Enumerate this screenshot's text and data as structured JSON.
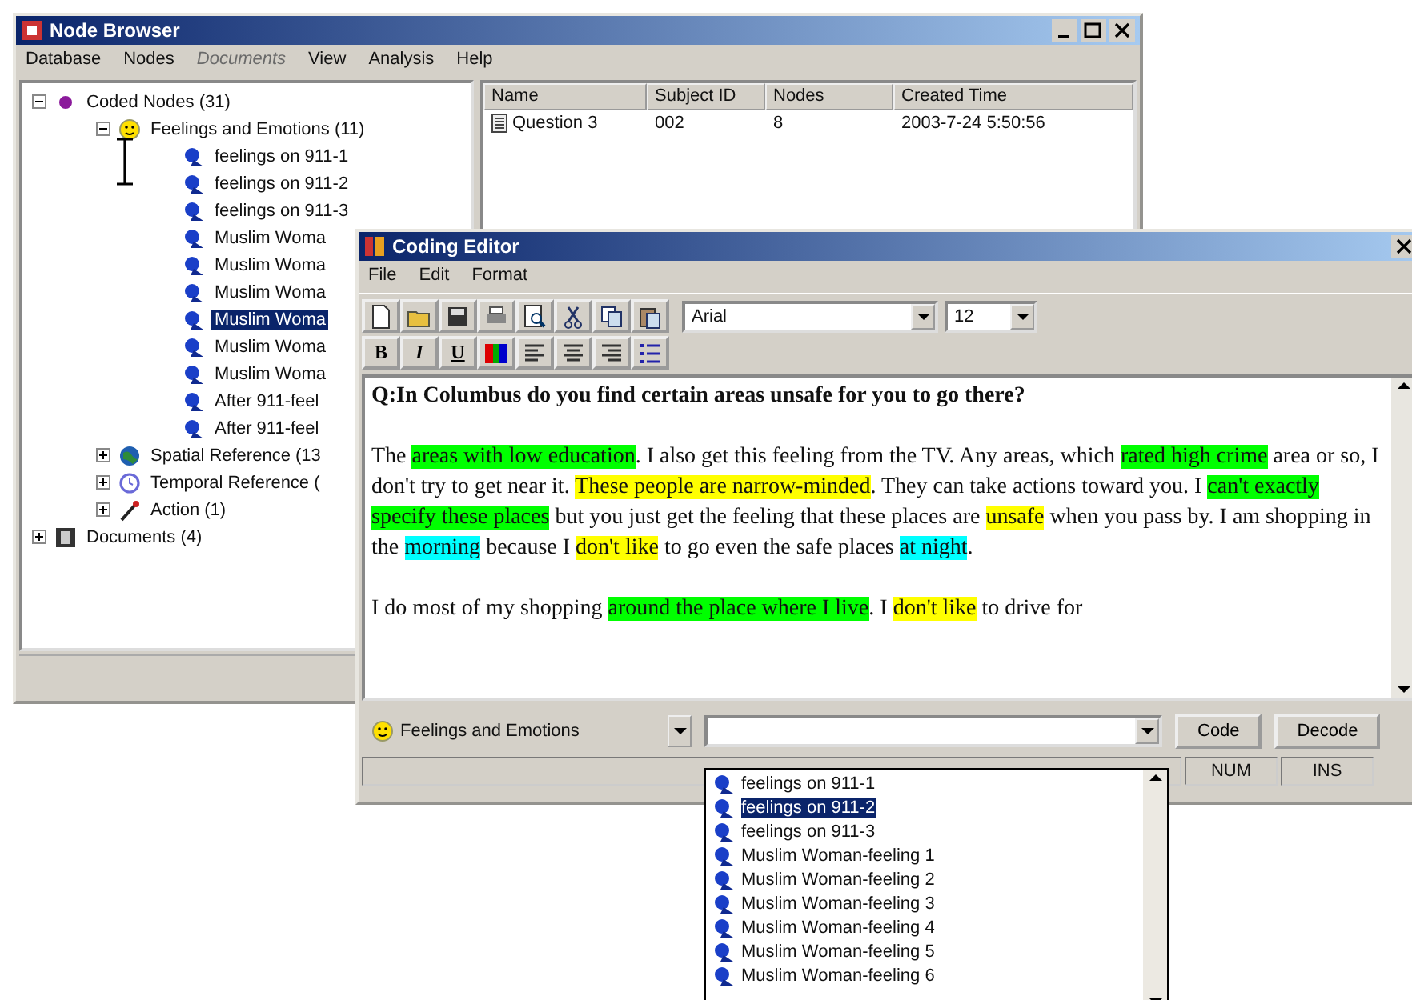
{
  "node_browser": {
    "title": "Node Browser",
    "menu": [
      {
        "label": "Database",
        "disabled": false
      },
      {
        "label": "Nodes",
        "disabled": false
      },
      {
        "label": "Documents",
        "disabled": true
      },
      {
        "label": "View",
        "disabled": false
      },
      {
        "label": "Analysis",
        "disabled": false
      },
      {
        "label": "Help",
        "disabled": false
      }
    ],
    "tree": [
      {
        "label": "Coded Nodes (31)",
        "kind": "dot",
        "expanded": true,
        "selected": false,
        "children": [
          {
            "label": "Feelings and Emotions (11)",
            "kind": "smiley",
            "expanded": true,
            "selected": false,
            "children": [
              {
                "label": "feelings on 911-1",
                "kind": "node",
                "selected": false
              },
              {
                "label": "feelings on 911-2",
                "kind": "node",
                "selected": false
              },
              {
                "label": "feelings on 911-3",
                "kind": "node",
                "selected": false
              },
              {
                "label": "Muslim Woma",
                "kind": "node",
                "selected": false
              },
              {
                "label": "Muslim Woma",
                "kind": "node",
                "selected": false
              },
              {
                "label": "Muslim Woma",
                "kind": "node",
                "selected": false
              },
              {
                "label": "Muslim Woma",
                "kind": "node",
                "selected": true
              },
              {
                "label": "Muslim Woma",
                "kind": "node",
                "selected": false
              },
              {
                "label": "Muslim Woma",
                "kind": "node",
                "selected": false
              },
              {
                "label": "After 911-feel",
                "kind": "node",
                "selected": false
              },
              {
                "label": "After 911-feel",
                "kind": "node",
                "selected": false
              }
            ]
          },
          {
            "label": "Spatial Reference (13",
            "kind": "globe",
            "expanded": false,
            "selected": false
          },
          {
            "label": "Temporal Reference (",
            "kind": "clock",
            "expanded": false,
            "selected": false
          },
          {
            "label": "Action (1)",
            "kind": "pen",
            "expanded": false,
            "selected": false
          }
        ]
      },
      {
        "label": "Documents (4)",
        "kind": "film",
        "expanded": false,
        "selected": false
      }
    ],
    "table": {
      "columns": [
        "Name",
        "Subject ID",
        "Nodes",
        "Created Time"
      ],
      "rows": [
        [
          "Question 3",
          "002",
          "8",
          "2003-7-24 5:50:56"
        ]
      ]
    }
  },
  "coding_editor": {
    "title": "Coding Editor",
    "menu": [
      "File",
      "Edit",
      "Format"
    ],
    "toolbar": [
      {
        "kind": "new"
      },
      {
        "kind": "open"
      },
      {
        "kind": "save"
      },
      {
        "kind": "print"
      },
      {
        "kind": "preview"
      },
      {
        "kind": "cut"
      },
      {
        "kind": "copy"
      },
      {
        "kind": "paste"
      }
    ],
    "font": "Arial",
    "size": "12",
    "format_buttons": [
      {
        "kind": "text",
        "label": "B"
      },
      {
        "kind": "text",
        "label": "I"
      },
      {
        "kind": "text",
        "label": "U"
      },
      {
        "kind": "color"
      },
      {
        "kind": "align-left"
      },
      {
        "kind": "align-center"
      },
      {
        "kind": "align-right"
      },
      {
        "kind": "list"
      }
    ],
    "question": "Q:In Columbus do you find certain areas unsafe for you to go there?",
    "paragraphs": [
      [
        {
          "text": "The "
        },
        {
          "text": "areas with low education",
          "color": "#00ff00"
        },
        {
          "text": ". I also get this feeling from the TV. Any areas, which "
        },
        {
          "text": "rated high crime",
          "color": "#00ff00"
        },
        {
          "text": " area or so, I don't try to get near it. "
        },
        {
          "text": "These people are narrow-minded",
          "color": "#ffff00"
        },
        {
          "text": ". They can take actions toward you. I "
        },
        {
          "text": "can't exactly specify these places",
          "color": "#00ff00"
        },
        {
          "text": " but you just get the feeling that these places are "
        },
        {
          "text": "unsafe",
          "color": "#ffff00"
        },
        {
          "text": " when you pass by. I am shopping in the "
        },
        {
          "text": "morning",
          "color": "#00ffff"
        },
        {
          "text": " because I "
        },
        {
          "text": "don't like",
          "color": "#ffff00"
        },
        {
          "text": " to go even the safe places "
        },
        {
          "text": "at night",
          "color": "#00ffff"
        },
        {
          "text": "."
        }
      ],
      [
        {
          "text": "I do most of my shopping "
        },
        {
          "text": "around the place where I live",
          "color": "#00ff00"
        },
        {
          "text": ". I "
        },
        {
          "text": "don't like",
          "color": "#ffff00"
        },
        {
          "text": " to drive for"
        }
      ]
    ],
    "category": "Feelings and Emotions",
    "buttons": [
      "Code",
      "Decode"
    ],
    "status": [
      "NUM",
      "INS"
    ],
    "dropdown": [
      {
        "label": "feelings on 911-1",
        "selected": false
      },
      {
        "label": "feelings on 911-2",
        "selected": true
      },
      {
        "label": "feelings on 911-3",
        "selected": false
      },
      {
        "label": "Muslim Woman-feeling 1",
        "selected": false
      },
      {
        "label": "Muslim Woman-feeling 2",
        "selected": false
      },
      {
        "label": "Muslim Woman-feeling 3",
        "selected": false
      },
      {
        "label": "Muslim Woman-feeling 4",
        "selected": false
      },
      {
        "label": "Muslim Woman-feeling 5",
        "selected": false
      },
      {
        "label": "Muslim Woman-feeling 6",
        "selected": false
      }
    ]
  }
}
